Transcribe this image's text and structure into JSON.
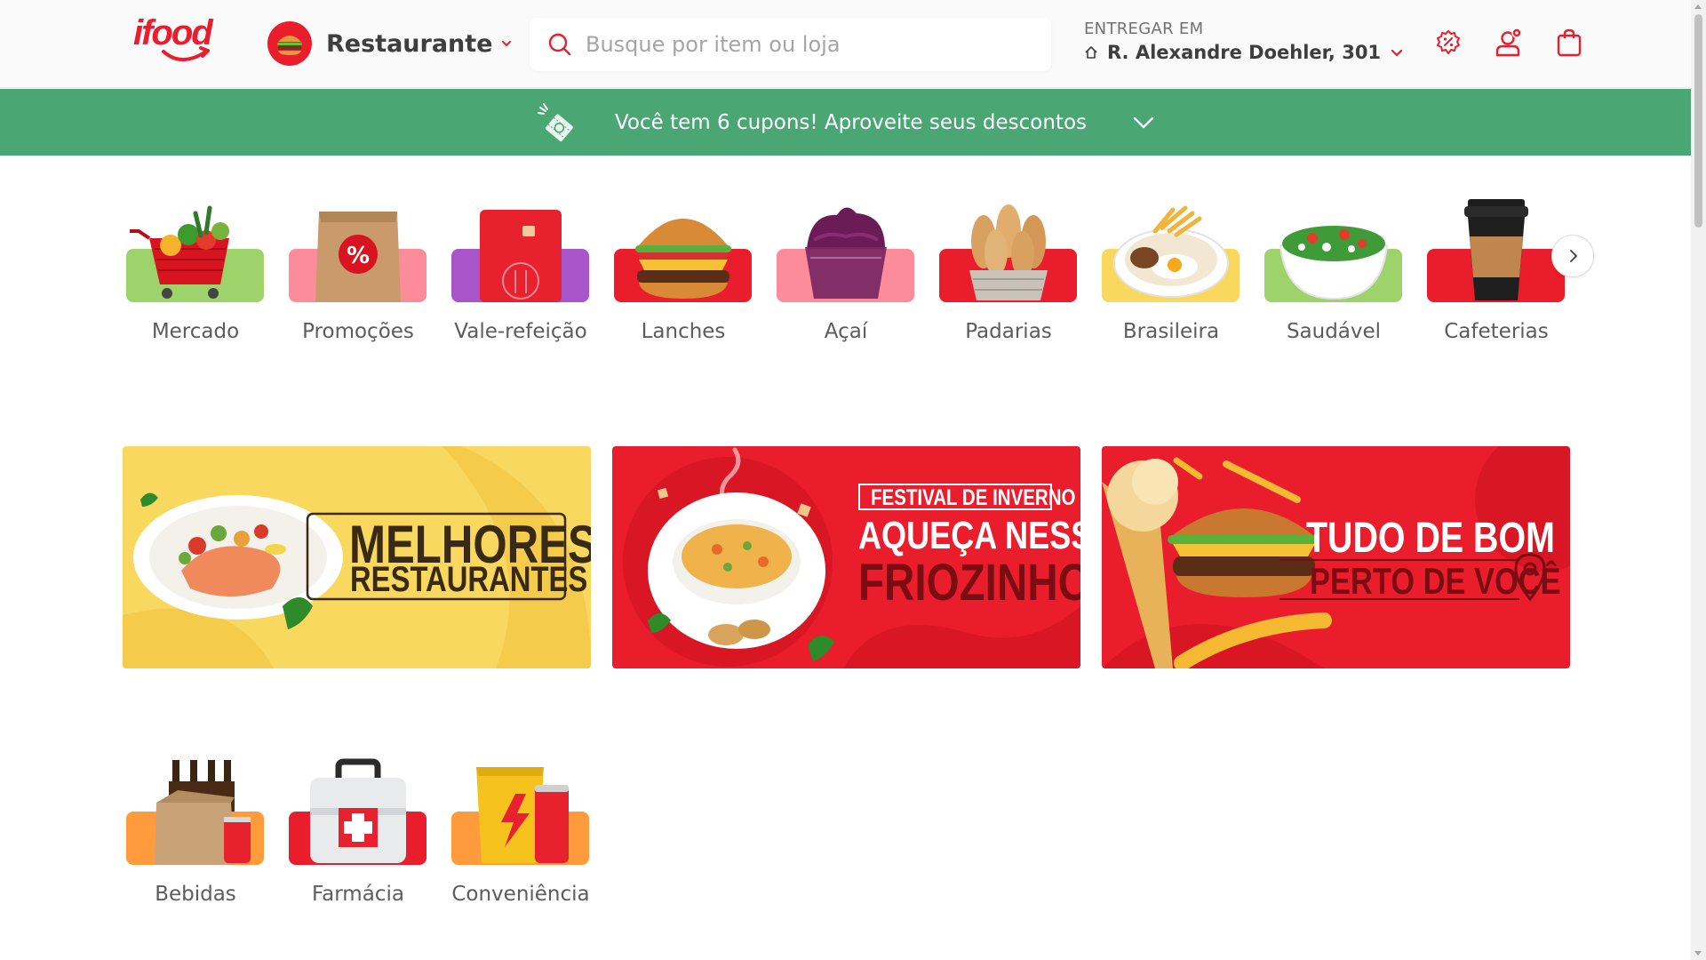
{
  "header": {
    "logo_text": "ifood",
    "category_selector": {
      "label": "Restaurante"
    },
    "search": {
      "placeholder": "Busque por item ou loja"
    },
    "delivery": {
      "label": "ENTREGAR EM",
      "address": "R. Alexandre Doehler, 301"
    }
  },
  "coupon_bar": {
    "text": "Você tem 6 cupons! Aproveite seus descontos"
  },
  "categories": [
    {
      "label": "Mercado",
      "icon": "grocery-cart-icon",
      "color": "#9ed26a"
    },
    {
      "label": "Promoções",
      "icon": "discount-bag-icon",
      "color": "#fd8c9a"
    },
    {
      "label": "Vale-refeição",
      "icon": "meal-card-icon",
      "color": "#a855c9"
    },
    {
      "label": "Lanches",
      "icon": "burger-icon",
      "color": "#ea1d2c"
    },
    {
      "label": "Açaí",
      "icon": "acai-cup-icon",
      "color": "#fd8c9a"
    },
    {
      "label": "Padarias",
      "icon": "bread-basket-icon",
      "color": "#ea1d2c"
    },
    {
      "label": "Brasileira",
      "icon": "rice-egg-plate-icon",
      "color": "#f9d85f"
    },
    {
      "label": "Saudável",
      "icon": "salad-bowl-icon",
      "color": "#9ed26a"
    },
    {
      "label": "Cafeterias",
      "icon": "coffee-cup-icon",
      "color": "#ea1d2c"
    }
  ],
  "categories_row2": [
    {
      "label": "Bebidas",
      "icon": "beer-pack-icon",
      "color": "#ff9a3d"
    },
    {
      "label": "Farmácia",
      "icon": "first-aid-kit-icon",
      "color": "#ea1d2c"
    },
    {
      "label": "Conveniência",
      "icon": "snack-soda-icon",
      "color": "#ff9a3d"
    }
  ],
  "banners": [
    {
      "line1": "MELHORES",
      "line2": "RESTAURANTES",
      "bg": "#f9d85f"
    },
    {
      "tag": "FESTIVAL DE INVERNO",
      "line1": "AQUEÇA NESSE",
      "line2": "FRIOZINHO",
      "bg": "#ea1d2c"
    },
    {
      "line1": "TUDO DE BOM",
      "line2": "PERTO DE VOCÊ",
      "bg": "#ea1d2c"
    }
  ],
  "colors": {
    "brand_red": "#ea1d2c",
    "coupon_green": "#4aa773",
    "text_dark": "#3f3e3e"
  }
}
